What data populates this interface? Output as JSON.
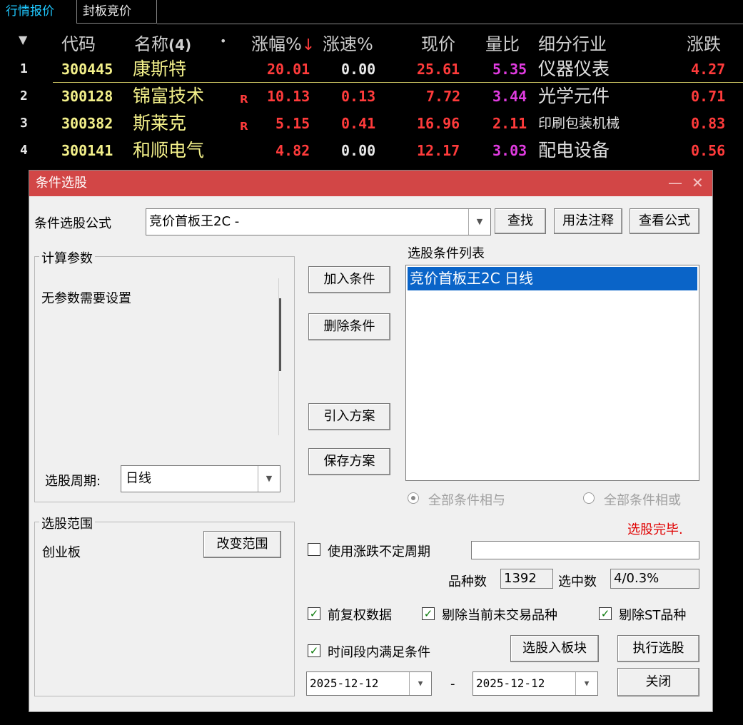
{
  "tabs": [
    {
      "label": "行情报价",
      "active": true
    },
    {
      "label": "封板竞价",
      "active": false
    }
  ],
  "table": {
    "headers": {
      "sort_arrow": "▼",
      "code": "代码",
      "name": "名称",
      "name_count": "(4)",
      "dot": "•",
      "change_pct": "涨幅%",
      "sort_indicator": "↓",
      "speed_pct": "涨速%",
      "price": "现价",
      "vol_ratio": "量比",
      "industry": "细分行业",
      "change": "涨跌"
    },
    "rows": [
      {
        "idx": "1",
        "code": "300445",
        "name": "康斯特",
        "flag": "",
        "change_pct": "20.01",
        "speed": "0.00",
        "price": "25.61",
        "vol_ratio": "5.35",
        "industry": "仪器仪表",
        "change": "4.27"
      },
      {
        "idx": "2",
        "code": "300128",
        "name": "锦富技术",
        "flag": "R",
        "change_pct": "10.13",
        "speed": "0.13",
        "price": "7.72",
        "vol_ratio": "3.44",
        "industry": "光学元件",
        "change": "0.71"
      },
      {
        "idx": "3",
        "code": "300382",
        "name": "斯莱克",
        "flag": "R",
        "change_pct": "5.15",
        "speed": "0.41",
        "price": "16.96",
        "vol_ratio": "2.11",
        "industry": "印刷包装机械",
        "change": "0.83"
      },
      {
        "idx": "4",
        "code": "300141",
        "name": "和顺电气",
        "flag": "",
        "change_pct": "4.82",
        "speed": "0.00",
        "price": "12.17",
        "vol_ratio": "3.03",
        "industry": "配电设备",
        "change": "0.56"
      }
    ]
  },
  "dialog": {
    "title": "条件选股",
    "minimize": "—",
    "close": "✕",
    "formula_label": "条件选股公式",
    "formula_value": "竞价首板王2C  -",
    "btn_find": "查找",
    "btn_usage": "用法注释",
    "btn_view_formula": "查看公式",
    "params_group": "计算参数",
    "params_text": "无参数需要设置",
    "period_label": "选股周期:",
    "period_value": "日线",
    "btn_add": "加入条件",
    "btn_delete": "删除条件",
    "btn_import": "引入方案",
    "btn_save": "保存方案",
    "list_title": "选股条件列表",
    "list_items": [
      "竞价首板王2C  日线"
    ],
    "radio_and": "全部条件相与",
    "radio_or": "全部条件相或",
    "status": "选股完毕.",
    "range_group": "选股范围",
    "range_value": "创业板",
    "btn_change_range": "改变范围",
    "use_cycle_label": "使用涨跌不定周期",
    "count_label": "品种数",
    "count_value": "1392",
    "selected_label": "选中数",
    "selected_value": "4/0.3%",
    "cb_adjusted": "前复权数据",
    "cb_remove_untraded": "剔除当前未交易品种",
    "cb_remove_st": "剔除ST品种",
    "cb_time_range": "时间段内满足条件",
    "btn_to_block": "选股入板块",
    "btn_execute": "执行选股",
    "btn_close": "关闭",
    "date_from": "2025-12-12",
    "date_sep": "-",
    "date_to": "2025-12-12"
  },
  "colors": {
    "title_bar": "#d24646",
    "active_tab": "#1fc8ff",
    "up_red": "#ff3b3b",
    "code_yellow": "#f3f08a",
    "vol_magenta": "#e03be0",
    "selection": "#0a64c8",
    "status_red": "#e00000"
  }
}
